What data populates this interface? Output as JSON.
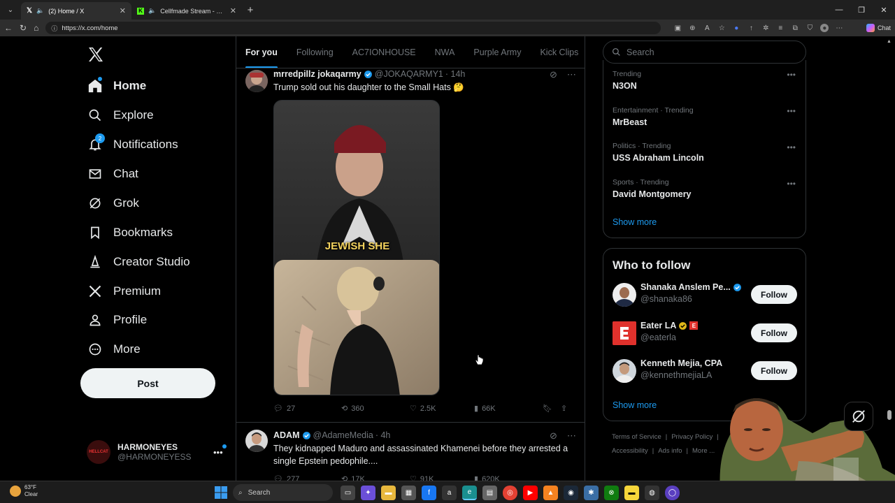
{
  "browser": {
    "tabs": [
      {
        "title": "(2) Home / X",
        "active": true,
        "icon": "x-logo-icon"
      },
      {
        "title": "Cellfmade Stream - Watch Liv",
        "active": false,
        "icon": "kick-icon"
      }
    ],
    "url": "https://x.com/home",
    "copilot_label": "Chat"
  },
  "nav": {
    "items": [
      {
        "label": "Home",
        "icon": "home-icon"
      },
      {
        "label": "Explore",
        "icon": "search-icon"
      },
      {
        "label": "Notifications",
        "icon": "bell-icon",
        "badge": "2"
      },
      {
        "label": "Chat",
        "icon": "mail-icon"
      },
      {
        "label": "Grok",
        "icon": "grok-icon"
      },
      {
        "label": "Bookmarks",
        "icon": "bookmark-icon"
      },
      {
        "label": "Creator Studio",
        "icon": "creator-studio-icon"
      },
      {
        "label": "Premium",
        "icon": "x-logo-icon"
      },
      {
        "label": "Profile",
        "icon": "person-icon"
      },
      {
        "label": "More",
        "icon": "more-circle-icon"
      }
    ],
    "post_label": "Post",
    "account": {
      "name": "HARMONEYES",
      "handle": "@HARMONEYESS",
      "avatar_text": "HELLCAT"
    }
  },
  "feed_tabs": [
    "For you",
    "Following",
    "AC7IONHOUSE",
    "NWA",
    "Purple Army",
    "Kick Clips"
  ],
  "tweets": [
    {
      "name": "mrredpillz jokaqarmy",
      "handle": "@JOKAQARMY1",
      "time": "· 14h",
      "text": "Trump sold out his daughter to the Small Hats 🤔",
      "media_caption": "JEWISH SHE",
      "stats": {
        "replies": "27",
        "reposts": "360",
        "likes": "2.5K",
        "views": "66K"
      }
    },
    {
      "name": "ADAM",
      "handle": "@AdameMedia",
      "time": "· 4h",
      "text": "They kidnapped Maduro and assassinated Khamenei before they arrested a single Epstein pedophile....",
      "stats": {
        "replies": "277",
        "reposts": "17K",
        "likes": "91K",
        "views": "620K"
      }
    }
  ],
  "search_placeholder": "Search",
  "trends": [
    {
      "context": "Trending",
      "title": "N3ON"
    },
    {
      "context": "Entertainment · Trending",
      "title": "MrBeast"
    },
    {
      "context": "Politics · Trending",
      "title": "USS Abraham Lincoln"
    },
    {
      "context": "Sports · Trending",
      "title": "David Montgomery"
    }
  ],
  "show_more": "Show more",
  "who_to_follow": {
    "title": "Who to follow",
    "accounts": [
      {
        "name": "Shanaka Anslem Pe...",
        "handle": "@shanaka86",
        "follow": "Follow"
      },
      {
        "name": "Eater LA",
        "handle": "@eaterla",
        "follow": "Follow"
      },
      {
        "name": "Kenneth Mejia, CPA",
        "handle": "@kennethmejiaLA",
        "follow": "Follow"
      }
    ],
    "show_more": "Show more"
  },
  "footer": {
    "links": [
      "Terms of Service",
      "Privacy Policy",
      "Accessibility",
      "Ads info",
      "More ..."
    ]
  },
  "taskbar": {
    "temp": "63°F",
    "condition": "Clear",
    "search_label": "Search"
  },
  "colors": {
    "accent": "#1d9bf0",
    "bg": "#000000",
    "border": "#2f3336",
    "muted": "#71767b"
  }
}
